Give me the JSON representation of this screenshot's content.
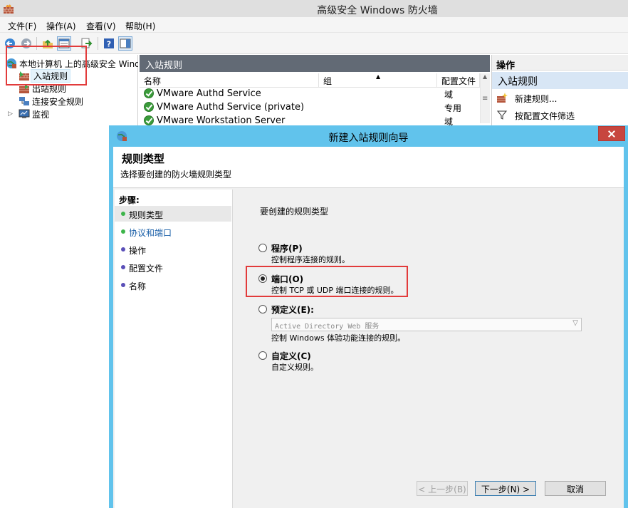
{
  "window": {
    "title": "高级安全 Windows 防火墙"
  },
  "menu": [
    "文件(F)",
    "操作(A)",
    "查看(V)",
    "帮助(H)"
  ],
  "toolbar": {
    "buttons": [
      "back-icon",
      "forward-icon",
      "up-folder-icon",
      "show-hide-console-tree-icon",
      "export-list-icon",
      "help-icon",
      "show-action-pane-icon"
    ]
  },
  "tree": {
    "root": "本地计算机 上的高级安全 Windows 防火墙",
    "items": [
      "入站规则",
      "出站规则",
      "连接安全规则",
      "监视"
    ]
  },
  "center": {
    "header": "入站规则",
    "columns": {
      "name": "名称",
      "group": "组",
      "profile": "配置文件"
    },
    "rows": [
      {
        "name": "VMware Authd Service",
        "profile": "域"
      },
      {
        "name": "VMware Authd Service (private)",
        "profile": "专用"
      },
      {
        "name": "VMware Workstation Server",
        "profile": "域"
      }
    ]
  },
  "actions": {
    "title": "操作",
    "section": "入站规则",
    "items": [
      "新建规则...",
      "按配置文件筛选"
    ]
  },
  "dialog": {
    "title": "新建入站规则向导",
    "header_title": "规则类型",
    "header_sub": "选择要创建的防火墙规则类型",
    "steps_title": "步骤:",
    "steps": [
      "规则类型",
      "协议和端口",
      "操作",
      "配置文件",
      "名称"
    ],
    "prompt": "要创建的规则类型",
    "options": [
      {
        "label": "程序(P)",
        "desc": "控制程序连接的规则。"
      },
      {
        "label": "端口(O)",
        "desc": "控制 TCP 或 UDP 端口连接的规则。"
      },
      {
        "label": "预定义(E):",
        "desc": "控制 Windows 体验功能连接的规则。"
      },
      {
        "label": "自定义(C)",
        "desc": "自定义规则。"
      }
    ],
    "predefined_value": "Active Directory Web 服务",
    "selected_option": "端口(O)",
    "buttons": {
      "back": "< 上一步(B)",
      "next": "下一步(N) >",
      "cancel": "取消"
    }
  },
  "colors": {
    "pane_header": "#626a75",
    "dialog_frame": "#61c3ec",
    "close_button": "#c7463f",
    "annotation": "#e23b3b",
    "step_current": "#3db54a",
    "step_other": "#5a4fb8"
  }
}
